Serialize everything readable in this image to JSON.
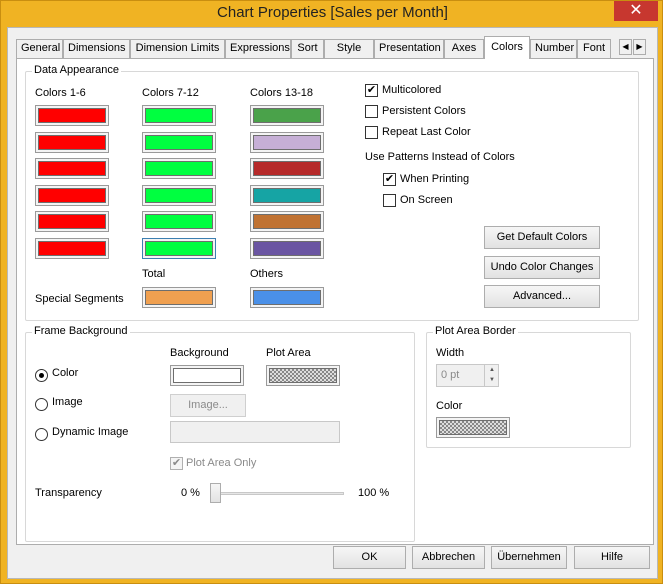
{
  "window": {
    "title": "Chart Properties [Sales per Month]",
    "close_glyph": "✕"
  },
  "tabs": [
    {
      "label": "General"
    },
    {
      "label": "Dimensions"
    },
    {
      "label": "Dimension Limits"
    },
    {
      "label": "Expressions"
    },
    {
      "label": "Sort"
    },
    {
      "label": "Style"
    },
    {
      "label": "Presentation"
    },
    {
      "label": "Axes"
    },
    {
      "label": "Colors",
      "active": true
    },
    {
      "label": "Number"
    },
    {
      "label": "Font"
    }
  ],
  "tab_scroll": {
    "left": "◀",
    "right": "▶"
  },
  "data_appearance": {
    "title": "Data Appearance",
    "col1_label": "Colors 1-6",
    "col2_label": "Colors 7-12",
    "col3_label": "Colors 13-18",
    "col1_colors": [
      "#ff0000",
      "#ff0000",
      "#ff0000",
      "#ff0000",
      "#ff0000",
      "#ff0000"
    ],
    "col2_colors": [
      "#00ff40",
      "#00ff40",
      "#00ff40",
      "#00ff40",
      "#00ff40",
      "#00ff40"
    ],
    "col3_colors": [
      "#4aa24a",
      "#c6afd6",
      "#b62a2a",
      "#16a4a4",
      "#c07232",
      "#6a55a2"
    ],
    "special_segments_label": "Special Segments",
    "total_label": "Total",
    "total_color": "#f0a050",
    "others_label": "Others",
    "others_color": "#4a90e8",
    "multicolored": {
      "label": "Multicolored",
      "checked": true
    },
    "persistent_colors": {
      "label": "Persistent Colors",
      "checked": false
    },
    "repeat_last_color": {
      "label": "Repeat Last Color",
      "checked": false
    },
    "patterns_label": "Use Patterns Instead of Colors",
    "when_printing": {
      "label": "When Printing",
      "checked": true
    },
    "on_screen": {
      "label": "On Screen",
      "checked": false
    },
    "get_default_colors": "Get Default Colors",
    "undo_color_changes": "Undo Color Changes",
    "advanced": "Advanced..."
  },
  "frame_background": {
    "title": "Frame Background",
    "background_label": "Background",
    "plot_area_label": "Plot Area",
    "background_color": "#ffffff",
    "option_color": {
      "label": "Color",
      "selected": true
    },
    "option_image": {
      "label": "Image",
      "selected": false
    },
    "option_dynamic_image": {
      "label": "Dynamic Image",
      "selected": false
    },
    "image_button": "Image...",
    "plot_area_only": {
      "label": "Plot Area Only",
      "checked": true
    },
    "transparency_label": "Transparency",
    "transparency_min": "0 %",
    "transparency_max": "100 %",
    "transparency_value": 0
  },
  "plot_area_border": {
    "title": "Plot Area Border",
    "width_label": "Width",
    "width_value": "0 pt",
    "color_label": "Color"
  },
  "footer": {
    "ok": "OK",
    "cancel": "Abbrechen",
    "apply": "Übernehmen",
    "help": "Hilfe"
  }
}
